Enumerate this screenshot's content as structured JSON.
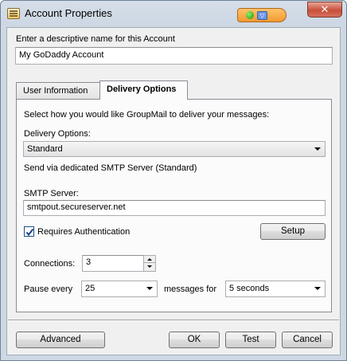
{
  "window": {
    "title": "Account Properties",
    "close_glyph": "✕",
    "badge_icon": "▽"
  },
  "account": {
    "name_label": "Enter a descriptive name for this Account",
    "name_value": "My GoDaddy Account"
  },
  "tabs": [
    {
      "label": "User Information",
      "active": false
    },
    {
      "label": "Delivery Options",
      "active": true
    }
  ],
  "delivery": {
    "intro": "Select how you would like GroupMail to deliver your messages:",
    "options_label": "Delivery Options:",
    "options_value": "Standard",
    "description": "Send via dedicated SMTP Server (Standard)",
    "smtp_label": "SMTP Server:",
    "smtp_value": "smtpout.secureserver.net",
    "auth_label": "Requires Authentication",
    "auth_checked": true,
    "setup_label": "Setup",
    "connections_label": "Connections:",
    "connections_value": "3",
    "pause_label": "Pause every",
    "pause_value": "25",
    "messages_for_label": "messages for",
    "duration_value": "5 seconds"
  },
  "footer": {
    "advanced_label": "Advanced",
    "ok_label": "OK",
    "test_label": "Test",
    "cancel_label": "Cancel"
  }
}
